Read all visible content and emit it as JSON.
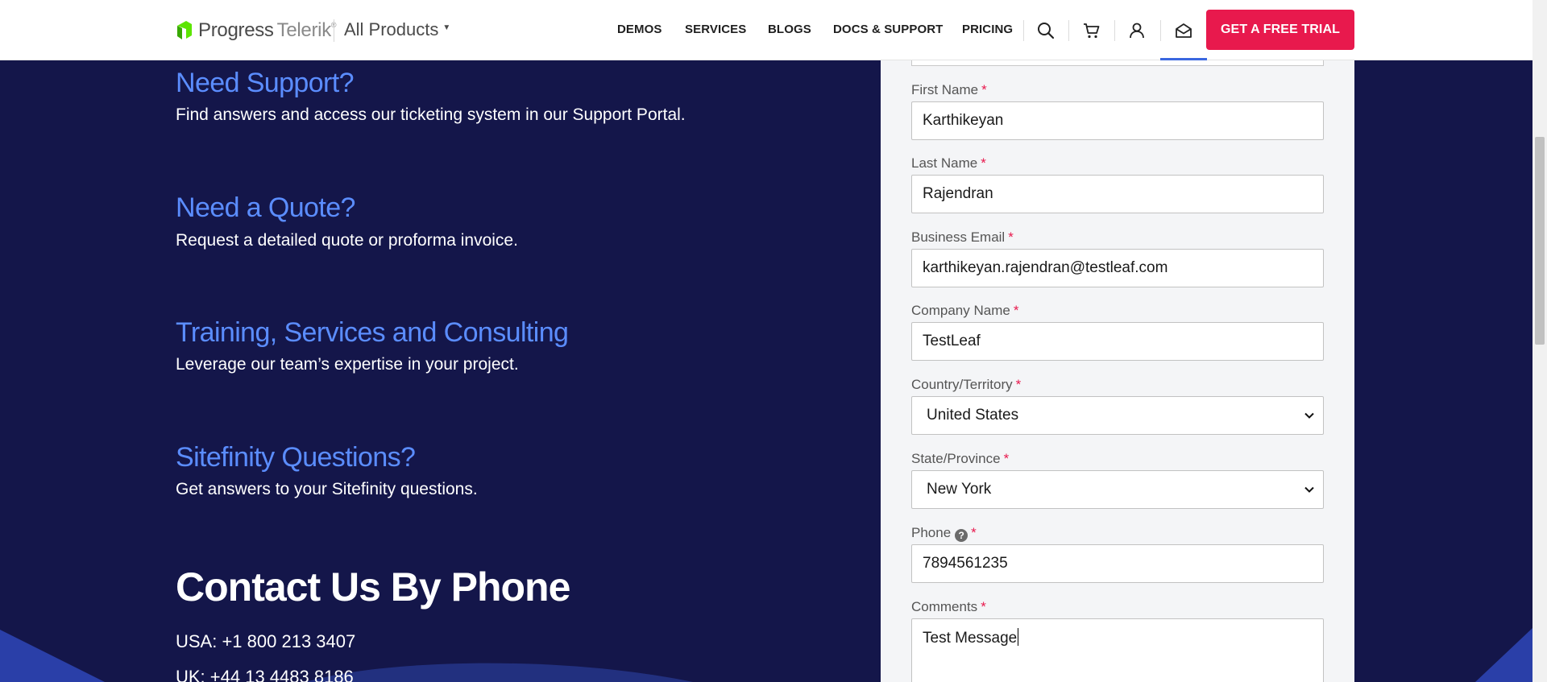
{
  "header": {
    "logo_progress": "Progress",
    "logo_telerik": "Telerik",
    "logo_tm": "®",
    "all_products": "All Products",
    "nav": [
      "DEMOS",
      "SERVICES",
      "BLOGS",
      "DOCS & SUPPORT",
      "PRICING"
    ],
    "trial_button": "GET A FREE TRIAL",
    "icons": [
      "search-icon",
      "cart-icon",
      "user-icon",
      "envelope-icon"
    ]
  },
  "left": {
    "sections": [
      {
        "title": "Need Support?",
        "text": "Find answers and access our ticketing system in our Support Portal."
      },
      {
        "title": "Need a Quote?",
        "text": "Request a detailed quote or proforma invoice."
      },
      {
        "title": "Training, Services and Consulting",
        "text": "Leverage our team’s expertise in your project."
      },
      {
        "title": "Sitefinity Questions?",
        "text": "Get answers to your Sitefinity questions."
      }
    ],
    "phone_title": "Contact Us By Phone",
    "phones": [
      "USA: +1 800 213 3407",
      "UK: +44 13 4483 8186"
    ]
  },
  "form": {
    "first_name": {
      "label": "First Name",
      "value": "Karthikeyan"
    },
    "last_name": {
      "label": "Last Name",
      "value": "Rajendran"
    },
    "email": {
      "label": "Business Email",
      "value": "karthikeyan.rajendran@testleaf.com"
    },
    "company": {
      "label": "Company Name",
      "value": "TestLeaf"
    },
    "country": {
      "label": "Country/Territory",
      "value": "United States"
    },
    "state": {
      "label": "State/Province",
      "value": "New York"
    },
    "phone": {
      "label": "Phone",
      "value": "7894561235",
      "help": "?"
    },
    "comments": {
      "label": "Comments",
      "value": "Test Message"
    },
    "required_mark": "*"
  },
  "colors": {
    "background": "#14164a",
    "accent_blue": "#5b8dff",
    "trial_red": "#e8194d",
    "logo_green": "#5ce500"
  }
}
